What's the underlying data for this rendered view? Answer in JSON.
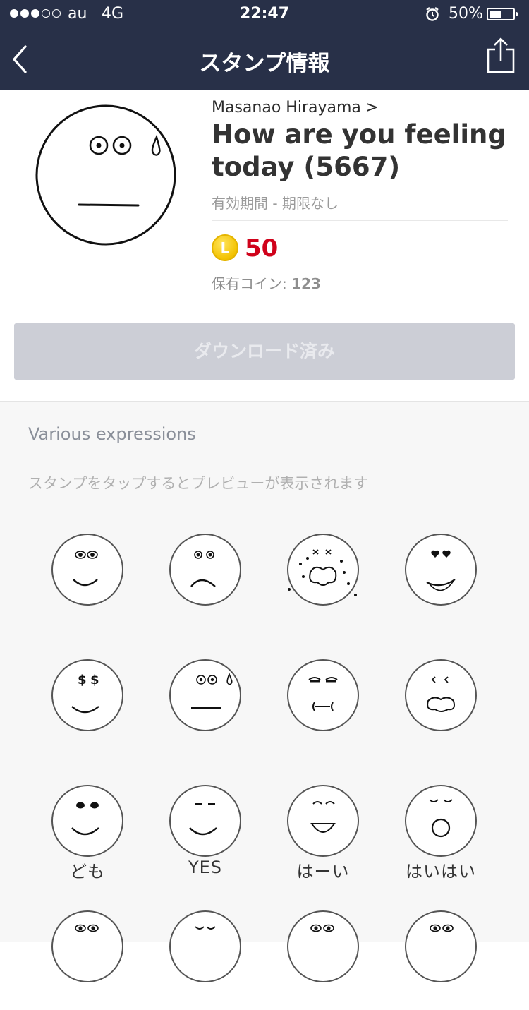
{
  "status_bar": {
    "carrier": "au",
    "network": "4G",
    "time": "22:47",
    "battery_percent": "50%",
    "battery_level": 0.5,
    "alarm_icon": "alarm-icon"
  },
  "nav": {
    "title": "スタンプ情報",
    "back_icon": "chevron-left-icon",
    "share_icon": "share-icon"
  },
  "sticker": {
    "author": "Masanao Hirayama",
    "author_chevron": ">",
    "title": "How are you feeling today (5667)",
    "validity": "有効期間 - 期限なし",
    "coin_letter": "L",
    "price": "50",
    "owned_label": "保有コイン: ",
    "owned_value": "123",
    "download_label": "ダウンロード済み"
  },
  "preview": {
    "section_title": "Various expressions",
    "hint": "スタンプをタップするとプレビューが表示されます",
    "stickers": [
      {
        "name": "sticker-smile",
        "label": ""
      },
      {
        "name": "sticker-sad",
        "label": ""
      },
      {
        "name": "sticker-dizzy",
        "label": ""
      },
      {
        "name": "sticker-love",
        "label": ""
      },
      {
        "name": "sticker-money",
        "label": ""
      },
      {
        "name": "sticker-sweat",
        "label": ""
      },
      {
        "name": "sticker-grimace",
        "label": ""
      },
      {
        "name": "sticker-shout",
        "label": ""
      },
      {
        "name": "sticker-domo",
        "label": "ども"
      },
      {
        "name": "sticker-yes",
        "label": "YES"
      },
      {
        "name": "sticker-haai",
        "label": "はーい"
      },
      {
        "name": "sticker-haihai",
        "label": "はいはい"
      }
    ]
  }
}
